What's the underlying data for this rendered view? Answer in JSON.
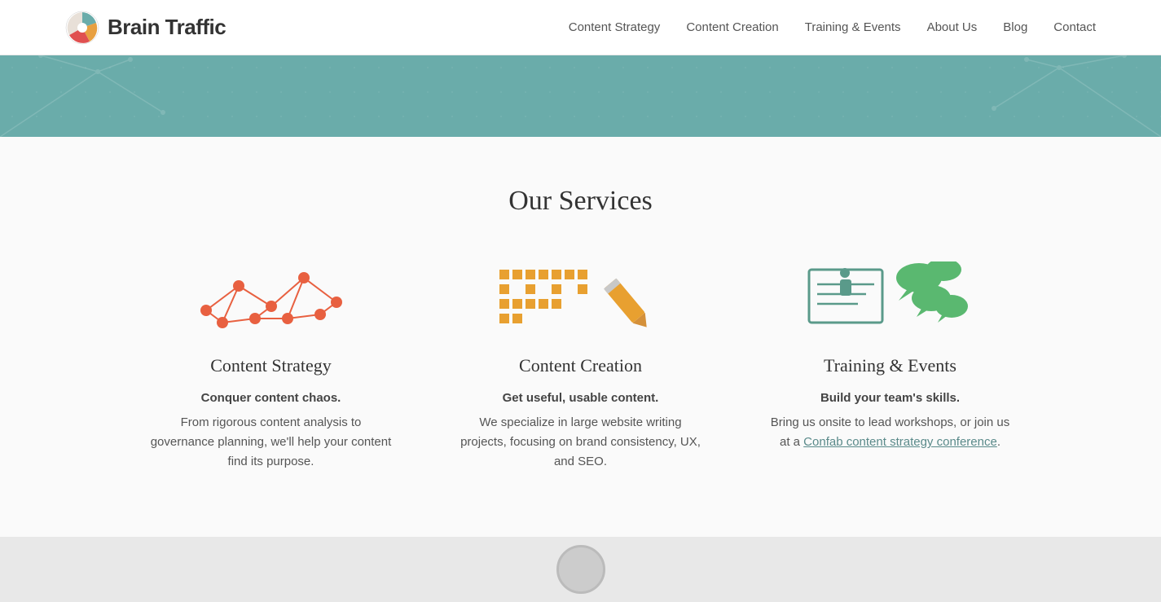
{
  "header": {
    "logo_text": "Brain Traffic",
    "nav_items": [
      {
        "label": "Content Strategy",
        "href": "#"
      },
      {
        "label": "Content Creation",
        "href": "#"
      },
      {
        "label": "Training & Events",
        "href": "#"
      },
      {
        "label": "About Us",
        "href": "#"
      },
      {
        "label": "Blog",
        "href": "#"
      },
      {
        "label": "Contact",
        "href": "#"
      }
    ]
  },
  "hero": {
    "alt": "Decorative banner"
  },
  "services": {
    "section_title": "Our Services",
    "cards": [
      {
        "name": "Content Strategy",
        "tagline": "Conquer content chaos.",
        "description": "From rigorous content analysis to governance planning, we'll help your content find its purpose.",
        "icon_type": "network"
      },
      {
        "name": "Content Creation",
        "tagline": "Get useful, usable content.",
        "description": "We specialize in large website writing projects, focusing on brand consistency, UX, and SEO.",
        "icon_type": "writing"
      },
      {
        "name": "Training & Events",
        "tagline": "Build your team's skills.",
        "description_before_link": "Bring us onsite to lead workshops, or join us at a ",
        "link_text": "Confab content strategy conference",
        "link_href": "#",
        "description_after_link": ".",
        "icon_type": "training"
      }
    ]
  },
  "footer": {
    "avatar_alt": "Profile avatar"
  }
}
